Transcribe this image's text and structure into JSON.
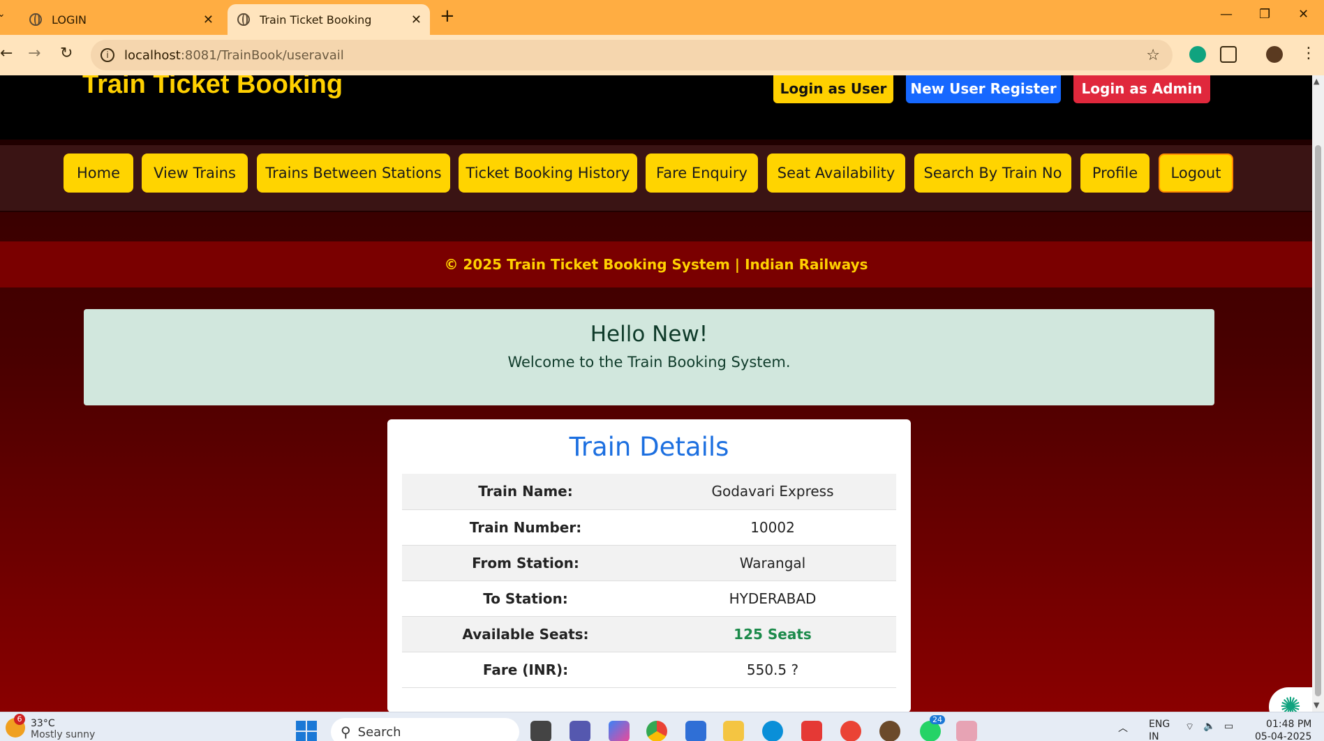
{
  "browser": {
    "tabs": [
      {
        "title": "LOGIN"
      },
      {
        "title": "Train Ticket Booking"
      }
    ],
    "url_host": "localhost",
    "url_rest": ":8081/TrainBook/useravail"
  },
  "header": {
    "site_title": "Train Ticket Booking",
    "login_user": "Login as User",
    "new_user": "New User Register",
    "login_admin": "Login as Admin"
  },
  "menu": {
    "items": [
      "Home",
      "View Trains",
      "Trains Between Stations",
      "Ticket Booking History",
      "Fare Enquiry",
      "Seat Availability",
      "Search By Train No",
      "Profile",
      "Logout"
    ]
  },
  "banner": {
    "text": "© 2025 Train Ticket Booking System | Indian Railways"
  },
  "welcome": {
    "title": "Hello New!",
    "message": "Welcome to the Train Booking System."
  },
  "train_details": {
    "heading": "Train Details",
    "rows": [
      {
        "label": "Train Name:",
        "value": "Godavari Express"
      },
      {
        "label": "Train Number:",
        "value": "10002"
      },
      {
        "label": "From Station:",
        "value": "Warangal"
      },
      {
        "label": "To Station:",
        "value": "HYDERABAD"
      },
      {
        "label": "Available Seats:",
        "value": "125 Seats"
      },
      {
        "label": "Fare (INR):",
        "value": "550.5 ?"
      }
    ]
  },
  "taskbar": {
    "weather_temp": "33°C",
    "weather_desc": "Mostly sunny",
    "weather_badge": "6",
    "search_placeholder": "Search",
    "whatsapp_badge": "24",
    "lang_top": "ENG",
    "lang_bottom": "IN",
    "time": "01:48 PM",
    "date": "05-04-2025"
  },
  "colors": {
    "accent_yellow": "#ffd400",
    "register_blue": "#1668ff",
    "admin_red": "#e0283c",
    "heading_blue": "#1c6fe0",
    "seats_green": "#1b8a4a"
  }
}
